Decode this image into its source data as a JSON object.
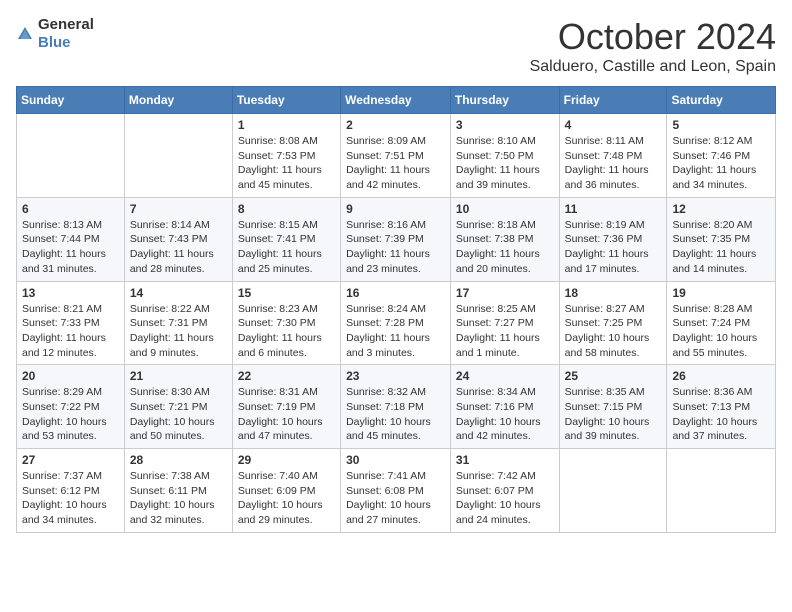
{
  "header": {
    "logo_general": "General",
    "logo_blue": "Blue",
    "month_title": "October 2024",
    "location": "Salduero, Castille and Leon, Spain"
  },
  "days_of_week": [
    "Sunday",
    "Monday",
    "Tuesday",
    "Wednesday",
    "Thursday",
    "Friday",
    "Saturday"
  ],
  "weeks": [
    [
      {
        "day": "",
        "detail": ""
      },
      {
        "day": "",
        "detail": ""
      },
      {
        "day": "1",
        "detail": "Sunrise: 8:08 AM\nSunset: 7:53 PM\nDaylight: 11 hours and 45 minutes."
      },
      {
        "day": "2",
        "detail": "Sunrise: 8:09 AM\nSunset: 7:51 PM\nDaylight: 11 hours and 42 minutes."
      },
      {
        "day": "3",
        "detail": "Sunrise: 8:10 AM\nSunset: 7:50 PM\nDaylight: 11 hours and 39 minutes."
      },
      {
        "day": "4",
        "detail": "Sunrise: 8:11 AM\nSunset: 7:48 PM\nDaylight: 11 hours and 36 minutes."
      },
      {
        "day": "5",
        "detail": "Sunrise: 8:12 AM\nSunset: 7:46 PM\nDaylight: 11 hours and 34 minutes."
      }
    ],
    [
      {
        "day": "6",
        "detail": "Sunrise: 8:13 AM\nSunset: 7:44 PM\nDaylight: 11 hours and 31 minutes."
      },
      {
        "day": "7",
        "detail": "Sunrise: 8:14 AM\nSunset: 7:43 PM\nDaylight: 11 hours and 28 minutes."
      },
      {
        "day": "8",
        "detail": "Sunrise: 8:15 AM\nSunset: 7:41 PM\nDaylight: 11 hours and 25 minutes."
      },
      {
        "day": "9",
        "detail": "Sunrise: 8:16 AM\nSunset: 7:39 PM\nDaylight: 11 hours and 23 minutes."
      },
      {
        "day": "10",
        "detail": "Sunrise: 8:18 AM\nSunset: 7:38 PM\nDaylight: 11 hours and 20 minutes."
      },
      {
        "day": "11",
        "detail": "Sunrise: 8:19 AM\nSunset: 7:36 PM\nDaylight: 11 hours and 17 minutes."
      },
      {
        "day": "12",
        "detail": "Sunrise: 8:20 AM\nSunset: 7:35 PM\nDaylight: 11 hours and 14 minutes."
      }
    ],
    [
      {
        "day": "13",
        "detail": "Sunrise: 8:21 AM\nSunset: 7:33 PM\nDaylight: 11 hours and 12 minutes."
      },
      {
        "day": "14",
        "detail": "Sunrise: 8:22 AM\nSunset: 7:31 PM\nDaylight: 11 hours and 9 minutes."
      },
      {
        "day": "15",
        "detail": "Sunrise: 8:23 AM\nSunset: 7:30 PM\nDaylight: 11 hours and 6 minutes."
      },
      {
        "day": "16",
        "detail": "Sunrise: 8:24 AM\nSunset: 7:28 PM\nDaylight: 11 hours and 3 minutes."
      },
      {
        "day": "17",
        "detail": "Sunrise: 8:25 AM\nSunset: 7:27 PM\nDaylight: 11 hours and 1 minute."
      },
      {
        "day": "18",
        "detail": "Sunrise: 8:27 AM\nSunset: 7:25 PM\nDaylight: 10 hours and 58 minutes."
      },
      {
        "day": "19",
        "detail": "Sunrise: 8:28 AM\nSunset: 7:24 PM\nDaylight: 10 hours and 55 minutes."
      }
    ],
    [
      {
        "day": "20",
        "detail": "Sunrise: 8:29 AM\nSunset: 7:22 PM\nDaylight: 10 hours and 53 minutes."
      },
      {
        "day": "21",
        "detail": "Sunrise: 8:30 AM\nSunset: 7:21 PM\nDaylight: 10 hours and 50 minutes."
      },
      {
        "day": "22",
        "detail": "Sunrise: 8:31 AM\nSunset: 7:19 PM\nDaylight: 10 hours and 47 minutes."
      },
      {
        "day": "23",
        "detail": "Sunrise: 8:32 AM\nSunset: 7:18 PM\nDaylight: 10 hours and 45 minutes."
      },
      {
        "day": "24",
        "detail": "Sunrise: 8:34 AM\nSunset: 7:16 PM\nDaylight: 10 hours and 42 minutes."
      },
      {
        "day": "25",
        "detail": "Sunrise: 8:35 AM\nSunset: 7:15 PM\nDaylight: 10 hours and 39 minutes."
      },
      {
        "day": "26",
        "detail": "Sunrise: 8:36 AM\nSunset: 7:13 PM\nDaylight: 10 hours and 37 minutes."
      }
    ],
    [
      {
        "day": "27",
        "detail": "Sunrise: 7:37 AM\nSunset: 6:12 PM\nDaylight: 10 hours and 34 minutes."
      },
      {
        "day": "28",
        "detail": "Sunrise: 7:38 AM\nSunset: 6:11 PM\nDaylight: 10 hours and 32 minutes."
      },
      {
        "day": "29",
        "detail": "Sunrise: 7:40 AM\nSunset: 6:09 PM\nDaylight: 10 hours and 29 minutes."
      },
      {
        "day": "30",
        "detail": "Sunrise: 7:41 AM\nSunset: 6:08 PM\nDaylight: 10 hours and 27 minutes."
      },
      {
        "day": "31",
        "detail": "Sunrise: 7:42 AM\nSunset: 6:07 PM\nDaylight: 10 hours and 24 minutes."
      },
      {
        "day": "",
        "detail": ""
      },
      {
        "day": "",
        "detail": ""
      }
    ]
  ]
}
